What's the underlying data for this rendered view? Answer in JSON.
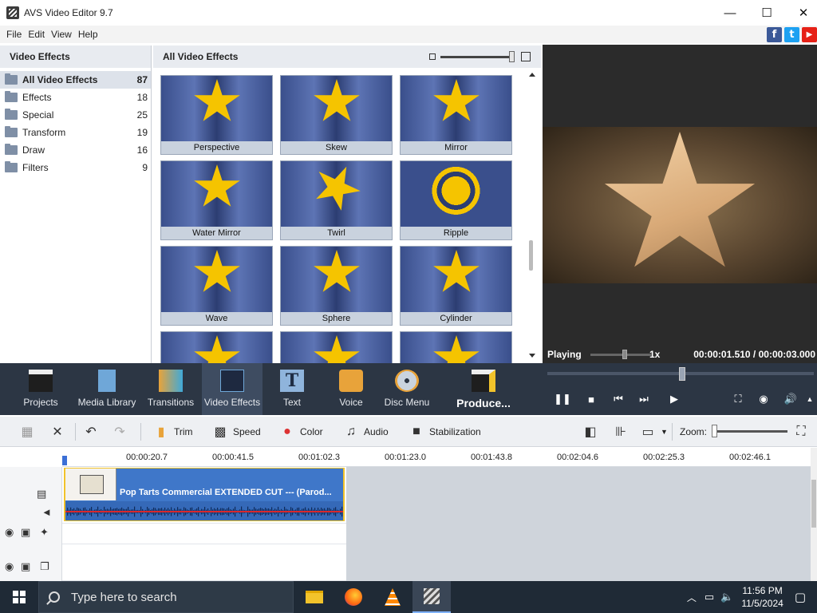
{
  "window": {
    "title": "AVS Video Editor 9.7",
    "minimize": "—",
    "maximize": "☐",
    "close": "✕"
  },
  "menu": [
    "File",
    "Edit",
    "View",
    "Help"
  ],
  "social": [
    "f",
    "t",
    "▶"
  ],
  "categories": {
    "header": "Video Effects",
    "items": [
      {
        "label": "All Video Effects",
        "count": "87"
      },
      {
        "label": "Effects",
        "count": "18"
      },
      {
        "label": "Special",
        "count": "25"
      },
      {
        "label": "Transform",
        "count": "19"
      },
      {
        "label": "Draw",
        "count": "16"
      },
      {
        "label": "Filters",
        "count": "9"
      }
    ]
  },
  "gallery": {
    "title": "All Video Effects",
    "tiles": [
      "Perspective",
      "Skew",
      "Mirror",
      "Water Mirror",
      "Twirl",
      "Ripple",
      "Wave",
      "Sphere",
      "Cylinder",
      "",
      "",
      ""
    ]
  },
  "preview": {
    "status": "Playing",
    "speed": "1x",
    "time": "00:00:01.510 / 00:00:03.000"
  },
  "toolbar": {
    "projects": "Projects",
    "media_library": "Media Library",
    "transitions": "Transitions",
    "video_effects": "Video Effects",
    "text": "Text",
    "voice": "Voice",
    "disc_menu": "Disc Menu",
    "produce": "Produce..."
  },
  "edit_tools": {
    "trim": "Trim",
    "speed": "Speed",
    "color": "Color",
    "audio": "Audio",
    "stabilization": "Stabilization",
    "zoom": "Zoom:"
  },
  "timeline": {
    "ticks": [
      "00:00:20.7",
      "00:00:41.5",
      "00:01:02.3",
      "00:01:23.0",
      "00:01:43.8",
      "00:02:04.6",
      "00:02:25.3",
      "00:02:46.1"
    ],
    "clip_title": "Pop Tarts Commercial EXTENDED CUT --- (Parod..."
  },
  "taskbar": {
    "search_placeholder": "Type here to search",
    "time": "11:56 PM",
    "date": "11/5/2024"
  },
  "colors": {
    "accent_dark": "#2c3644",
    "clip_blue": "#3f77c9",
    "clip_border": "#f2c32b",
    "star": "#f5c400"
  }
}
